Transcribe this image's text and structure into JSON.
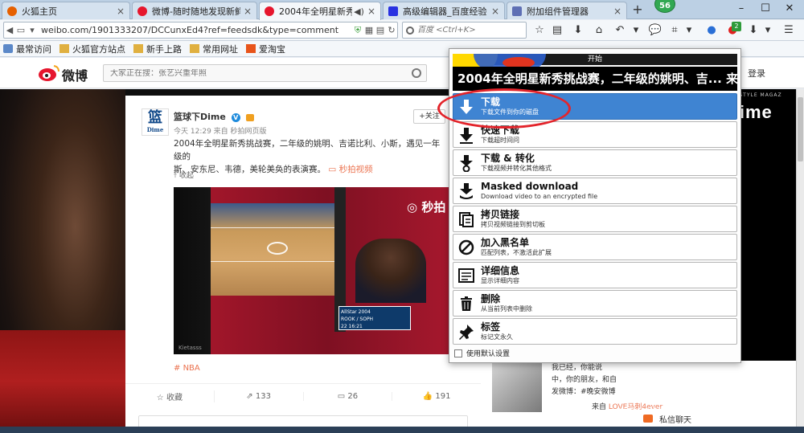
{
  "tabs": [
    {
      "label": "火狐主页",
      "color": "#e66000"
    },
    {
      "label": "微博-随时随地发现新鲜事",
      "color": "#e6162d"
    },
    {
      "label": "2004年全明星新秀挑...",
      "color": "#e6162d",
      "active": true
    },
    {
      "label": "高级编辑器_百度经验",
      "color": "#2932e1"
    },
    {
      "label": "附加组件管理器",
      "color": "#5e6fb4"
    }
  ],
  "profile_badge": "56",
  "url": "weibo.com/1901333207/DCCunxEd4?ref=feedsdk&type=comment",
  "search_placeholder": "百度 <Ctrl+K>",
  "addon_badge": "2",
  "bookmarks": [
    "最常访问",
    "火狐官方站点",
    "新手上路",
    "常用网址",
    "爱淘宝"
  ],
  "weibo": {
    "logo_text": "微博",
    "search_placeholder": "大家正在搜：张艺兴重年照",
    "login": "登录"
  },
  "post": {
    "avatar_main": "篮",
    "avatar_sub": "Dime",
    "author": "篮球下Dime",
    "meta": "今天 12:29 来自 秒拍网页版",
    "follow": "+关注",
    "text_main": "2004年全明星新秀挑战赛，二年级的姚明、吉诺比利、小斯，遇见一年级的",
    "text_line2": "斯、安东尼、韦德，美轮美奂的表演赛。",
    "video_link": "秒拍视频",
    "collapse": "收起",
    "video_watermark": "秒拍",
    "video_corner": "Kietasss",
    "scoreboard": [
      "AllStar 2004",
      "ROOK",
      "SOPH",
      "22 16:21"
    ],
    "topic": "NBA",
    "actions": {
      "fav": "收藏",
      "forward": "133",
      "comment": "26",
      "like": "191"
    }
  },
  "right": {
    "banner": "LIFESTYLE MAGAZ",
    "logo": "Dime",
    "card_text": [
      "我已经，你能说",
      "中，你的朋友，和自",
      "发微博：#晚安微博"
    ],
    "card_from_prefix": "来自 ",
    "card_from_link": "LOVE马刺4ever",
    "chat": "私信聊天",
    "watermark": "Baidu",
    "watermark2": "经验",
    "watermark_url": "jingyan.baidu.com"
  },
  "popup": {
    "header": "开始",
    "title": "2004年全明星新秀挑战赛，二年级的姚明、吉... 来自...",
    "items": [
      {
        "title": "下载",
        "sub": "下载文件到你的磁盘",
        "icon": "download-arrow-icon",
        "selected": true
      },
      {
        "title": "快速下载",
        "sub": "下载超时间问",
        "icon": "quick-download-icon"
      },
      {
        "title": "下载 & 转化",
        "sub": "下载视频并转化其他格式",
        "icon": "download-convert-icon"
      },
      {
        "title": "Masked download",
        "sub": "Download video to an encrypted file",
        "icon": "masked-download-icon"
      },
      {
        "title": "拷贝链接",
        "sub": "拷贝视频链接到剪切板",
        "icon": "copy-link-icon"
      },
      {
        "title": "加入黑名单",
        "sub": "匹配列表，不激活此扩展",
        "icon": "blacklist-icon"
      },
      {
        "title": "详细信息",
        "sub": "显示详细内容",
        "icon": "details-icon"
      },
      {
        "title": "删除",
        "sub": "从当前列表中删除",
        "icon": "delete-icon"
      },
      {
        "title": "标签",
        "sub": "标记文永久",
        "icon": "pin-icon"
      }
    ],
    "footer": "使用默认设置"
  }
}
